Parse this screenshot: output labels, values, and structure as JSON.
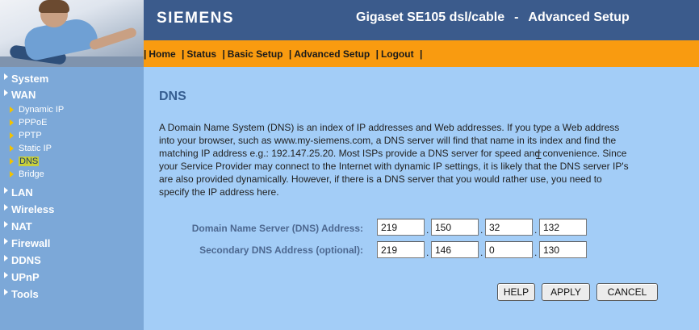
{
  "header": {
    "brand": "SIEMENS",
    "product": "Gigaset SE105 dsl/cable",
    "separator": "-",
    "section": "Advanced Setup"
  },
  "nav": {
    "items": [
      "Home",
      "Status",
      "Basic Setup",
      "Advanced Setup",
      "Logout"
    ]
  },
  "sidebar": {
    "items": [
      {
        "label": "System"
      },
      {
        "label": "WAN"
      },
      {
        "label": "LAN"
      },
      {
        "label": "Wireless"
      },
      {
        "label": "NAT"
      },
      {
        "label": "Firewall"
      },
      {
        "label": "DDNS"
      },
      {
        "label": "UPnP"
      },
      {
        "label": "Tools"
      }
    ],
    "wan_sub": [
      {
        "label": "Dynamic IP"
      },
      {
        "label": "PPPoE"
      },
      {
        "label": "PPTP"
      },
      {
        "label": "Static IP"
      },
      {
        "label": "DNS",
        "active": true
      },
      {
        "label": "Bridge"
      }
    ]
  },
  "main": {
    "title": "DNS",
    "description": [
      "A Domain Name System (DNS) is an index of IP addresses and Web addresses. If you type a Web address",
      "into your browser, such as www.my-siemens.com, a DNS server will find that name in its index and find the",
      "matching IP address e.g.: 192.147.25.20. Most ISPs provide a DNS server for speed and convenience. Since",
      "your Service Provider may connect to the Internet with dynamic IP settings, it is likely that the DNS server IP's",
      "are also provided dynamically. However, if there is a DNS server that you would rather use, you need to",
      "specify the IP address here."
    ],
    "primary_dns": {
      "label": "Domain Name Server (DNS) Address:",
      "octets": [
        "219",
        "150",
        "32",
        "132"
      ]
    },
    "secondary_dns": {
      "label": "Secondary DNS Address (optional):",
      "octets": [
        "219",
        "146",
        "0",
        "130"
      ]
    },
    "buttons": {
      "help": "HELP",
      "apply": "APPLY",
      "cancel": "CANCEL"
    }
  },
  "colors": {
    "header_bg": "#3b5b8c",
    "nav_bg": "#f99b10",
    "sidebar_bg": "#7ca8d8",
    "content_bg": "#a3cdf7",
    "title": "#365e91",
    "active_highlight": "#c8cf3a"
  }
}
